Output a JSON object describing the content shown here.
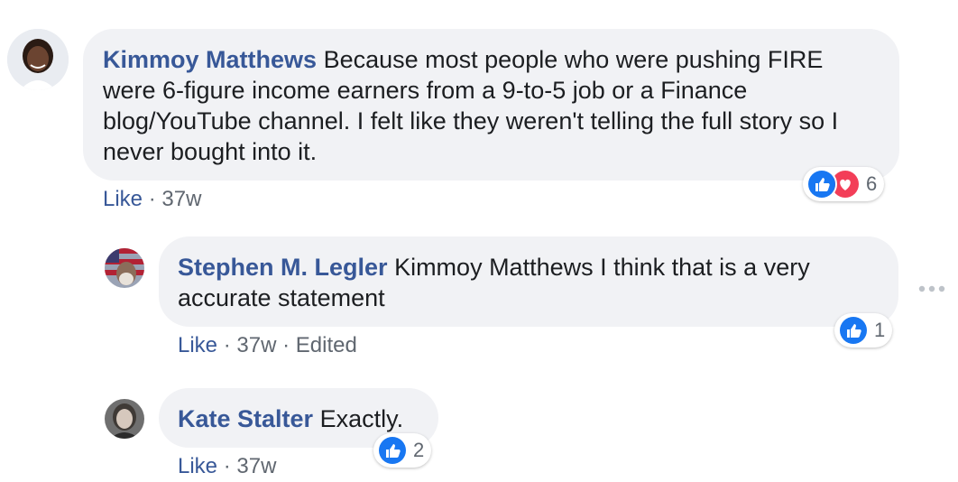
{
  "comments": [
    {
      "author": "Kimmoy Matthews",
      "text": "Because most people who were pushing FIRE were 6-figure income earners from a 9-to-5 job or a Finance blog/YouTube channel. I felt like they weren't telling the full story so I never bought into it.",
      "like_label": "Like",
      "time": "37w",
      "reaction_count": "6",
      "reactions": [
        "like-icon",
        "love-icon"
      ]
    },
    {
      "author": "Stephen M. Legler",
      "text": "Kimmoy Matthews I think that is a very accurate statement",
      "like_label": "Like",
      "time": "37w",
      "edited": "Edited",
      "reaction_count": "1",
      "reactions": [
        "like-icon"
      ]
    },
    {
      "author": "Kate Stalter",
      "text": "Exactly.",
      "like_label": "Like",
      "time": "37w",
      "reaction_count": "2",
      "reactions": [
        "like-icon"
      ]
    }
  ],
  "separator": "·",
  "colors": {
    "author": "#385898",
    "bubble": "#f1f2f5",
    "like_blue": "#1877f2",
    "love_red": "#f33e58",
    "meta": "#606770"
  }
}
